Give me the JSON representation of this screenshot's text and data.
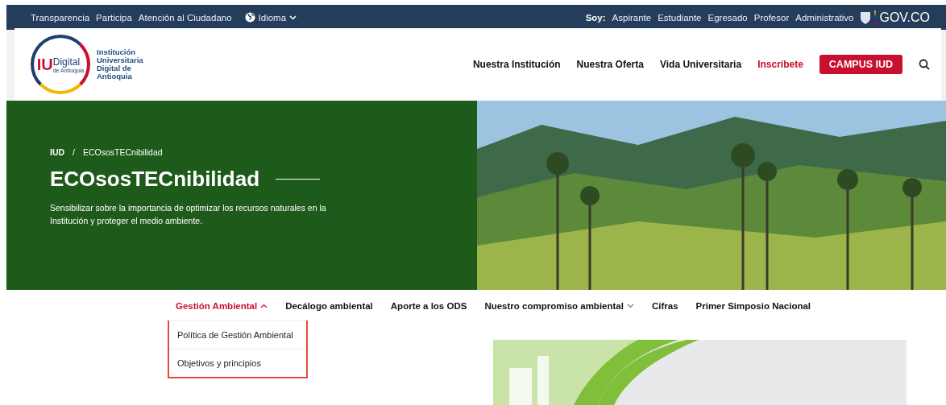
{
  "top_bar": {
    "links": [
      "Transparencia",
      "Participa",
      "Atención al Ciudadano"
    ],
    "language": "Idioma",
    "soy_label": "Soy:",
    "profiles": [
      "Aspirante",
      "Estudiante",
      "Egresado",
      "Profesor",
      "Administrativo"
    ],
    "gov": "GOV.CO"
  },
  "header": {
    "logo_mark": "IU",
    "logo_word": "Digital",
    "logo_sub": "de Antioquia",
    "logo_lines": [
      "Institución",
      "Universitaria",
      "Digital de",
      "Antioquia"
    ],
    "nav": [
      {
        "label": "Nuestra Institución",
        "kind": "link"
      },
      {
        "label": "Nuestra Oferta",
        "kind": "link"
      },
      {
        "label": "Vida Universitaria",
        "kind": "link"
      },
      {
        "label": "Inscríbete",
        "kind": "highlight"
      },
      {
        "label": "CAMPUS IUD",
        "kind": "button"
      }
    ]
  },
  "hero": {
    "breadcrumb": [
      "IUD",
      "ECOsosTECnibilidad"
    ],
    "separator": "/",
    "title": "ECOsosTECnibilidad",
    "description": "Sensibilizar sobre la importancia de optimizar los recursos naturales en la Institución y proteger el medio ambiente."
  },
  "subnav": [
    {
      "label": "Gestión Ambiental",
      "selected": true,
      "expanded": true,
      "menu": [
        "Política de Gestión Ambiental",
        "Objetivos y principios"
      ]
    },
    {
      "label": "Decálogo ambiental",
      "selected": false
    },
    {
      "label": "Aporte a los ODS",
      "selected": false
    },
    {
      "label": "Nuestro compromiso ambiental",
      "selected": false,
      "expanded": false
    },
    {
      "label": "Cifras",
      "selected": false
    },
    {
      "label": "Primer Simposio Nacional",
      "selected": false
    }
  ]
}
